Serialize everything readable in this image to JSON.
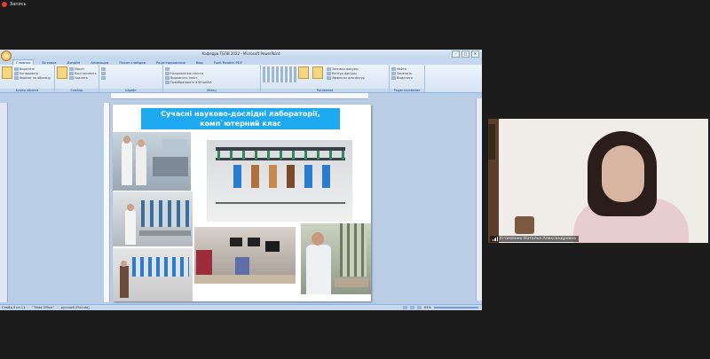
{
  "recording": {
    "label": "Запись"
  },
  "ppt": {
    "window_title": "Кафедра ТБПВ 2022 - Microsoft PowerPoint",
    "tabs": [
      "Главная",
      "Вставка",
      "Дизайн",
      "Анимация",
      "Показ слайдов",
      "Рецензирование",
      "Вид",
      "Foxit Reader PDF"
    ],
    "ribbon": {
      "groups": [
        {
          "label": "Буфер обмена",
          "items": [
            "Вставить",
            "Вырезать",
            "Копировать",
            "Формат по образцу"
          ]
        },
        {
          "label": "Слайды",
          "items": [
            "Создать слайд",
            "Макет",
            "Восстановить",
            "Удалить"
          ]
        },
        {
          "label": "Шрифт",
          "items": [
            "",
            "",
            ""
          ]
        },
        {
          "label": "Абзац",
          "items": [
            "",
            "Направление текста",
            "Выровнять текст",
            "Преобразовать в SmartArt"
          ]
        },
        {
          "label": "Рисование",
          "items": [
            "Упорядочить",
            "Экспресс-стили",
            "Заливка фигуры",
            "Контур фигуры",
            "Эффекты для фигур"
          ]
        },
        {
          "label": "Редактирование",
          "items": [
            "Найти",
            "Заменить",
            "Выделить"
          ]
        }
      ]
    },
    "slide": {
      "title_line1": "Сучасні науково-дослідні лабораторії,",
      "title_line2": "комп`ютерний клас"
    },
    "status": {
      "slide": "Слайд 4 из 11",
      "theme": "\"Тема Office\"",
      "language": "русский (Россия)",
      "zoom": "65%"
    }
  },
  "webcam": {
    "participant_name": "Устименко Наталья Александровна"
  },
  "colors": {
    "heading_bg": "#1eaaf1",
    "ribbon": "#d5e3f3",
    "background": "#1c1c1c"
  }
}
